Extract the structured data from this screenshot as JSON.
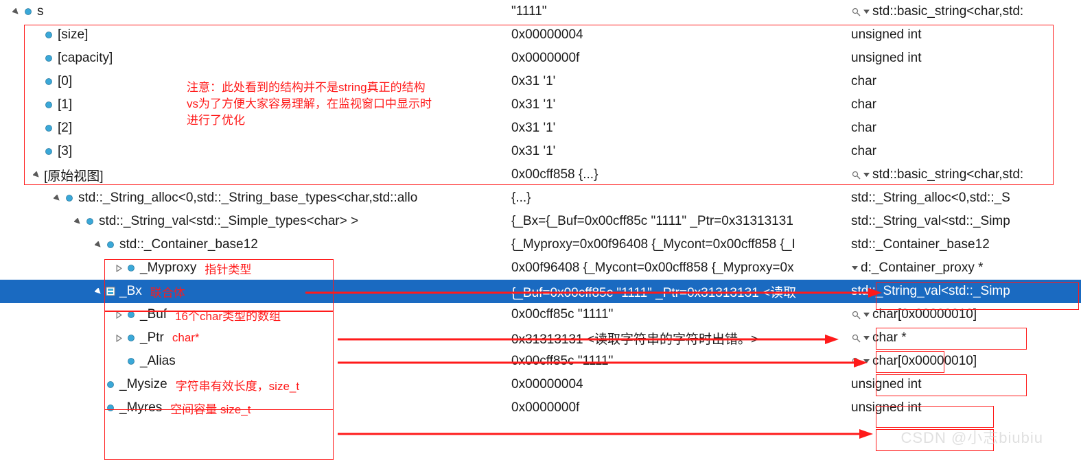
{
  "rows": [
    {
      "indent": 0,
      "exp": "open",
      "name": "s",
      "value": "\"1111\"",
      "type": "std::basic_string<char,std:",
      "mag": true,
      "dd": true
    },
    {
      "indent": 1,
      "exp": null,
      "name": "[size]",
      "value": "0x00000004",
      "type": "unsigned int"
    },
    {
      "indent": 1,
      "exp": null,
      "name": "[capacity]",
      "value": "0x0000000f",
      "type": "unsigned int"
    },
    {
      "indent": 1,
      "exp": null,
      "name": "[0]",
      "value": "0x31 '1'",
      "type": "char"
    },
    {
      "indent": 1,
      "exp": null,
      "name": "[1]",
      "value": "0x31 '1'",
      "type": "char"
    },
    {
      "indent": 1,
      "exp": null,
      "name": "[2]",
      "value": "0x31 '1'",
      "type": "char"
    },
    {
      "indent": 1,
      "exp": null,
      "name": "[3]",
      "value": "0x31 '1'",
      "type": "char"
    },
    {
      "indent": 1,
      "exp": "open",
      "name": "[原始视图]",
      "value": "0x00cff858 {...}",
      "type": "std::basic_string<char,std:",
      "mag": true,
      "dd": true,
      "noFieldIcon": true
    },
    {
      "indent": 2,
      "exp": "open",
      "name": "std::_String_alloc<0,std::_String_base_types<char,std::allo",
      "value": "{...}",
      "type": "std::_String_alloc<0,std::_S"
    },
    {
      "indent": 3,
      "exp": "open",
      "name": "std::_String_val<std::_Simple_types<char> >",
      "value": "{_Bx={_Buf=0x00cff85c \"1111\" _Ptr=0x31313131",
      "type": "std::_String_val<std::_Simp"
    },
    {
      "indent": 4,
      "exp": "open",
      "name": "std::_Container_base12",
      "value": "{_Myproxy=0x00f96408 {_Mycont=0x00cff858 {_I",
      "type": "std::_Container_base12"
    },
    {
      "indent": 5,
      "exp": "closed",
      "name": "_Myproxy",
      "note": "指针类型",
      "value": "0x00f96408 {_Mycont=0x00cff858 {_Myproxy=0x",
      "type": "_Container_proxy *",
      "mag": false,
      "dd": true,
      "typePre": "d:"
    },
    {
      "indent": 4,
      "exp": "open",
      "name": "_Bx",
      "note": "联合体",
      "value": "{_Buf=0x00cff85c \"1111\" _Ptr=0x31313131 <读取",
      "type": "std::_String_val<std::_Simp",
      "sel": true,
      "bxIcon": true
    },
    {
      "indent": 5,
      "exp": "closed",
      "name": "_Buf",
      "note": "16个char类型的数组",
      "value": "0x00cff85c \"1111\"",
      "type": "char[0x00000010]",
      "mag": true,
      "dd": true
    },
    {
      "indent": 5,
      "exp": "closed",
      "name": "_Ptr",
      "note": "char*",
      "value": "0x31313131 <读取字符串的字符时出错。>",
      "type": "char *",
      "mag": true,
      "dd": true
    },
    {
      "indent": 5,
      "exp": null,
      "name": "_Alias",
      "value": "0x00cff85c \"1111\"",
      "type": "char[0x00000010]",
      "mag": true,
      "dd": true
    },
    {
      "indent": 4,
      "exp": null,
      "name": "_Mysize",
      "note": "字符串有效长度，size_t",
      "value": "0x00000004",
      "type": "unsigned int"
    },
    {
      "indent": 4,
      "exp": null,
      "name": "_Myres",
      "note": "空间容量  size_t",
      "value": "0x0000000f",
      "type": "unsigned int"
    }
  ],
  "annotations": {
    "note1a": "注意：此处看到的结构并不是string真正的结构",
    "note1b": "vs为了方便大家容易理解，在监视窗口中显示时",
    "note1c": "进行了优化"
  },
  "watermark": "CSDN @小志biubiu"
}
